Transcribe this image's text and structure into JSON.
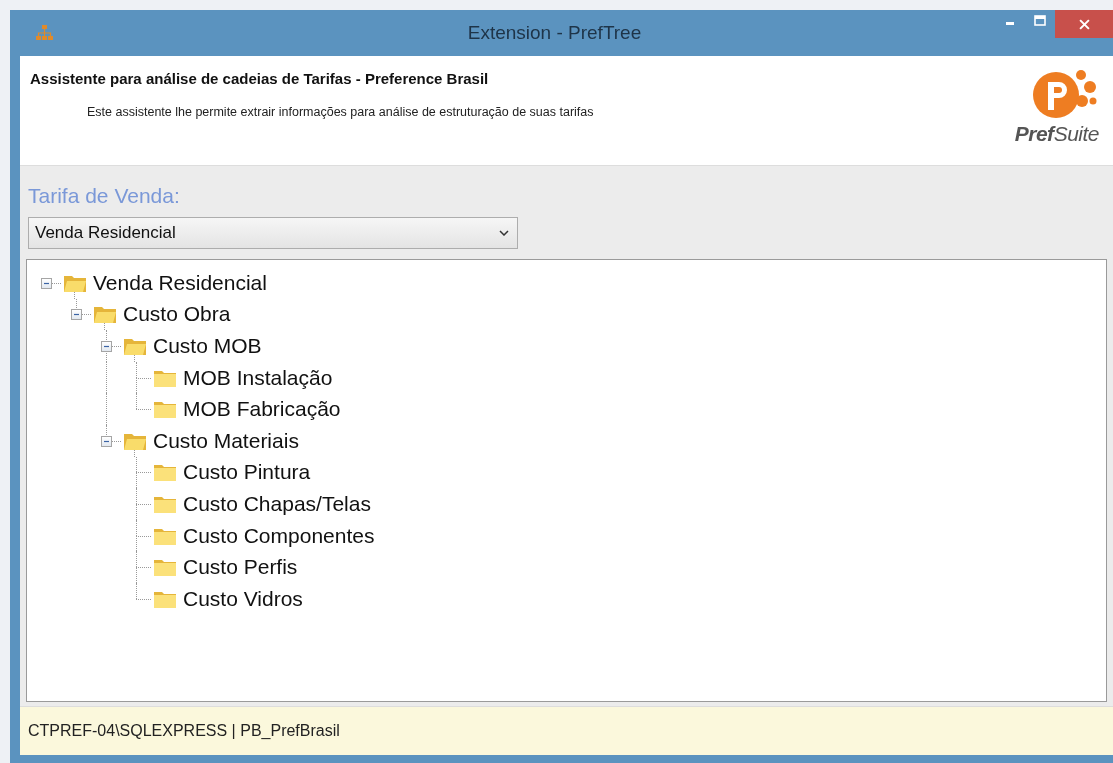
{
  "window": {
    "title": "Extension - PrefTree"
  },
  "header": {
    "title": "Assistente para análise de cadeias de Tarifas - Preference Brasil",
    "subtitle": "Este assistente lhe permite extrair informações para análise de estruturação de suas tarifas",
    "logo": "**Pref**Suite"
  },
  "tariff": {
    "label": "Tarifa de Venda:",
    "value": "Venda Residencial"
  },
  "tree": [
    {
      "label": "Venda Residencial",
      "expanded": true,
      "children": [
        {
          "label": "Custo Obra",
          "expanded": true,
          "children": [
            {
              "label": "Custo MOB",
              "expanded": true,
              "children": [
                {
                  "label": "MOB Instalação"
                },
                {
                  "label": "MOB Fabricação"
                }
              ]
            },
            {
              "label": "Custo Materiais",
              "expanded": true,
              "children": [
                {
                  "label": "Custo Pintura"
                },
                {
                  "label": "Custo Chapas/Telas"
                },
                {
                  "label": "Custo Componentes"
                },
                {
                  "label": "Custo Perfis"
                },
                {
                  "label": "Custo Vidros"
                }
              ]
            }
          ]
        }
      ]
    }
  ],
  "status_bar": "CTPREF-04\\SQLEXPRESS | PB_PrefBrasil"
}
